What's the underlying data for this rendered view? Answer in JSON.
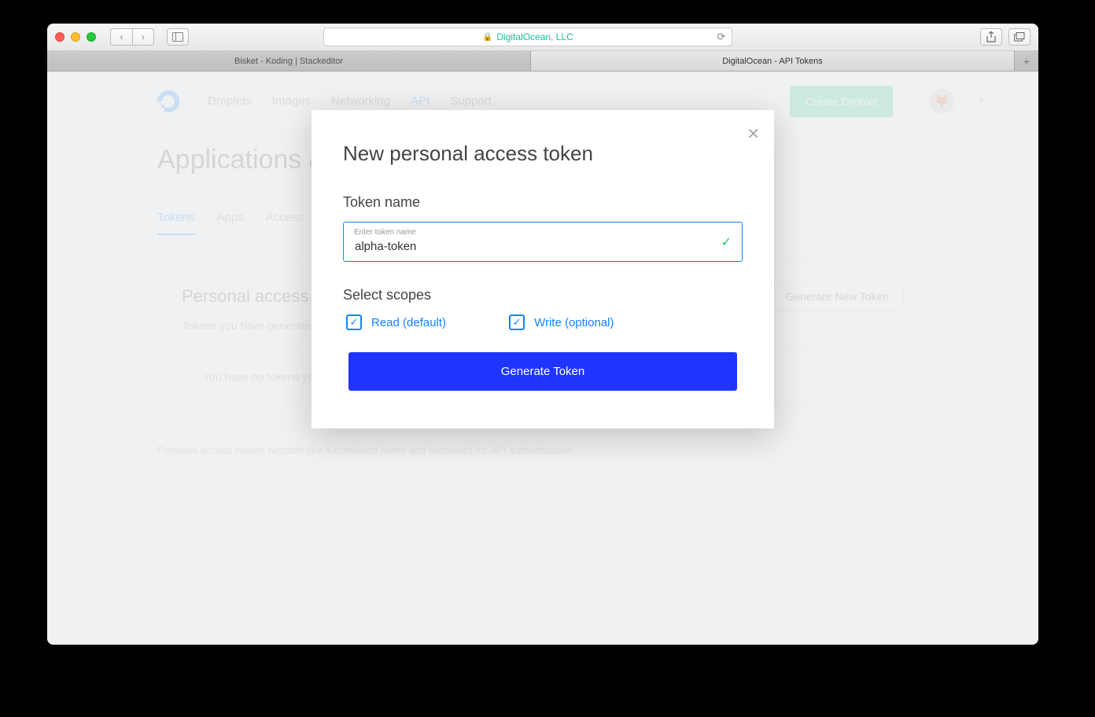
{
  "browser": {
    "url_display": "DigitalOcean, LLC",
    "tabs": [
      "Bisket - Koding | Stackeditor",
      "DigitalOcean - API Tokens"
    ]
  },
  "header": {
    "nav": [
      "Droplets",
      "Images",
      "Networking",
      "API",
      "Support"
    ],
    "create_label": "Create Droplet"
  },
  "page": {
    "title": "Applications & API",
    "subtabs": [
      "Tokens",
      "Apps",
      "Access"
    ],
    "panel_title": "Personal access tokens",
    "gen_new_label": "Generate New Token",
    "panel_desc": "Tokens you have generated to access the DigitalOcean API.",
    "empty_text": "You have no tokens yet.",
    "footer_note": "Personal access tokens function like a combined name and password for API authentication."
  },
  "modal": {
    "title": "New personal access token",
    "token_name_label": "Token name",
    "token_name_placeholder": "Enter token name",
    "token_name_value": "alpha-token",
    "scopes_label": "Select scopes",
    "scope_read": "Read (default)",
    "scope_write": "Write (optional)",
    "generate_label": "Generate Token"
  }
}
